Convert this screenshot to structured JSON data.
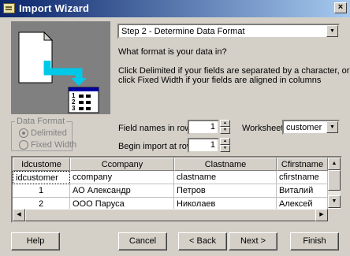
{
  "window": {
    "title": "Import Wizard",
    "close_label": "×"
  },
  "step_select": {
    "value": "Step 2 - Determine Data Format"
  },
  "question": "What format is your data in?",
  "help_lines": [
    "Click Delimited if your fields are separated by a character, or",
    "click Fixed Width if your fields are aligned in columns"
  ],
  "data_format": {
    "legend": "Data Format",
    "options": [
      {
        "label": "Delimited",
        "selected": true
      },
      {
        "label": "Fixed Width",
        "selected": false
      }
    ]
  },
  "field_names_row": {
    "label": "Field names in row:",
    "value": "1"
  },
  "begin_import_row": {
    "label": "Begin import at row:",
    "value": "1"
  },
  "worksheet": {
    "label": "Worksheet:",
    "value": "customer"
  },
  "grid": {
    "headers": [
      "Idcustome",
      "Ccompany",
      "Clastname",
      "Cfirstname"
    ],
    "rows": [
      [
        "idcustomer",
        "ccompany",
        "clastname",
        "cfirstname"
      ],
      [
        "1",
        "АО Александр",
        "Петров",
        "Виталий"
      ],
      [
        "2",
        "ООО Паруса",
        "Николаев",
        "Алексей"
      ]
    ]
  },
  "illustration": {
    "list_numbers": [
      "1",
      "2",
      "3"
    ]
  },
  "buttons": {
    "help": "Help",
    "cancel": "Cancel",
    "back": "< Back",
    "next": "Next >",
    "finish": "Finish"
  },
  "colors": {
    "title_start": "#0a246a",
    "title_end": "#a6caf0",
    "arrow": "#00c8e8",
    "face": "#d4d0c8"
  }
}
